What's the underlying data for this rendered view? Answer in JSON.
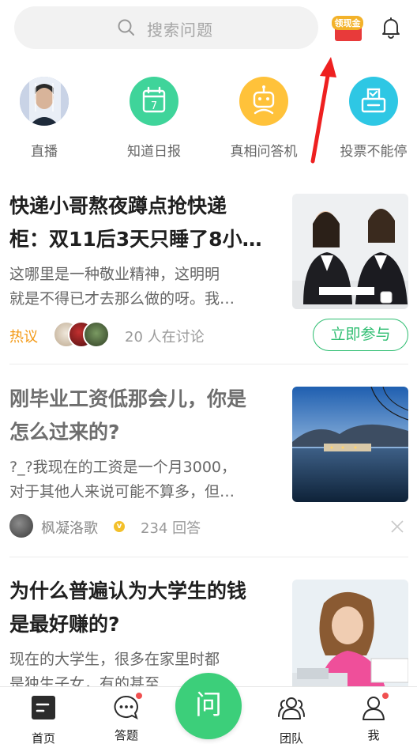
{
  "header": {
    "search_placeholder": "搜索问题",
    "cash_label": "领现金"
  },
  "quick_entries": [
    {
      "label": "直播",
      "icon": "live-avatar-icon"
    },
    {
      "label": "知道日报",
      "icon": "calendar-icon",
      "calendar_day": "7"
    },
    {
      "label": "真相问答机",
      "icon": "robot-icon"
    },
    {
      "label": "投票不能停",
      "icon": "vote-box-icon"
    }
  ],
  "cards": [
    {
      "title": "快递小哥熬夜蹲点抢快递柜：双11后3天只睡了8小…",
      "title_line1": "快递小哥熬夜蹲点抢快递",
      "title_line2": "柜：双11后3天只睡了8小…",
      "excerpt_line1": "这哪里是一种敬业精神，这明明",
      "excerpt_line2": "就是不得已才去那么做的呀。我…",
      "tag": "热议",
      "discuss": "20 人在讨论",
      "join": "立即参与"
    },
    {
      "title_line1": "刚毕业工资低那会儿，你是",
      "title_line2": "怎么过来的?",
      "excerpt_line1": "?_?我现在的工资是一个月3000，",
      "excerpt_line2": "对于其他人来说可能不算多，但…",
      "author": "枫凝洛歌",
      "verified": "v",
      "answers": "234 回答"
    },
    {
      "title_line1": "为什么普遍认为大学生的钱",
      "title_line2": "是最好赚的?",
      "excerpt_line1": "现在的大学生，很多在家里时都",
      "excerpt_line2": "是独生子女，有的甚至…"
    }
  ],
  "bottom_nav": {
    "home": "首页",
    "answer": "答题",
    "ask": "问",
    "team": "团队",
    "me": "我"
  },
  "colors": {
    "brand_green": "#3ccf7a",
    "hot_orange": "#f39a17",
    "badge_red": "#f05050",
    "annotation_red": "#ee2020"
  }
}
